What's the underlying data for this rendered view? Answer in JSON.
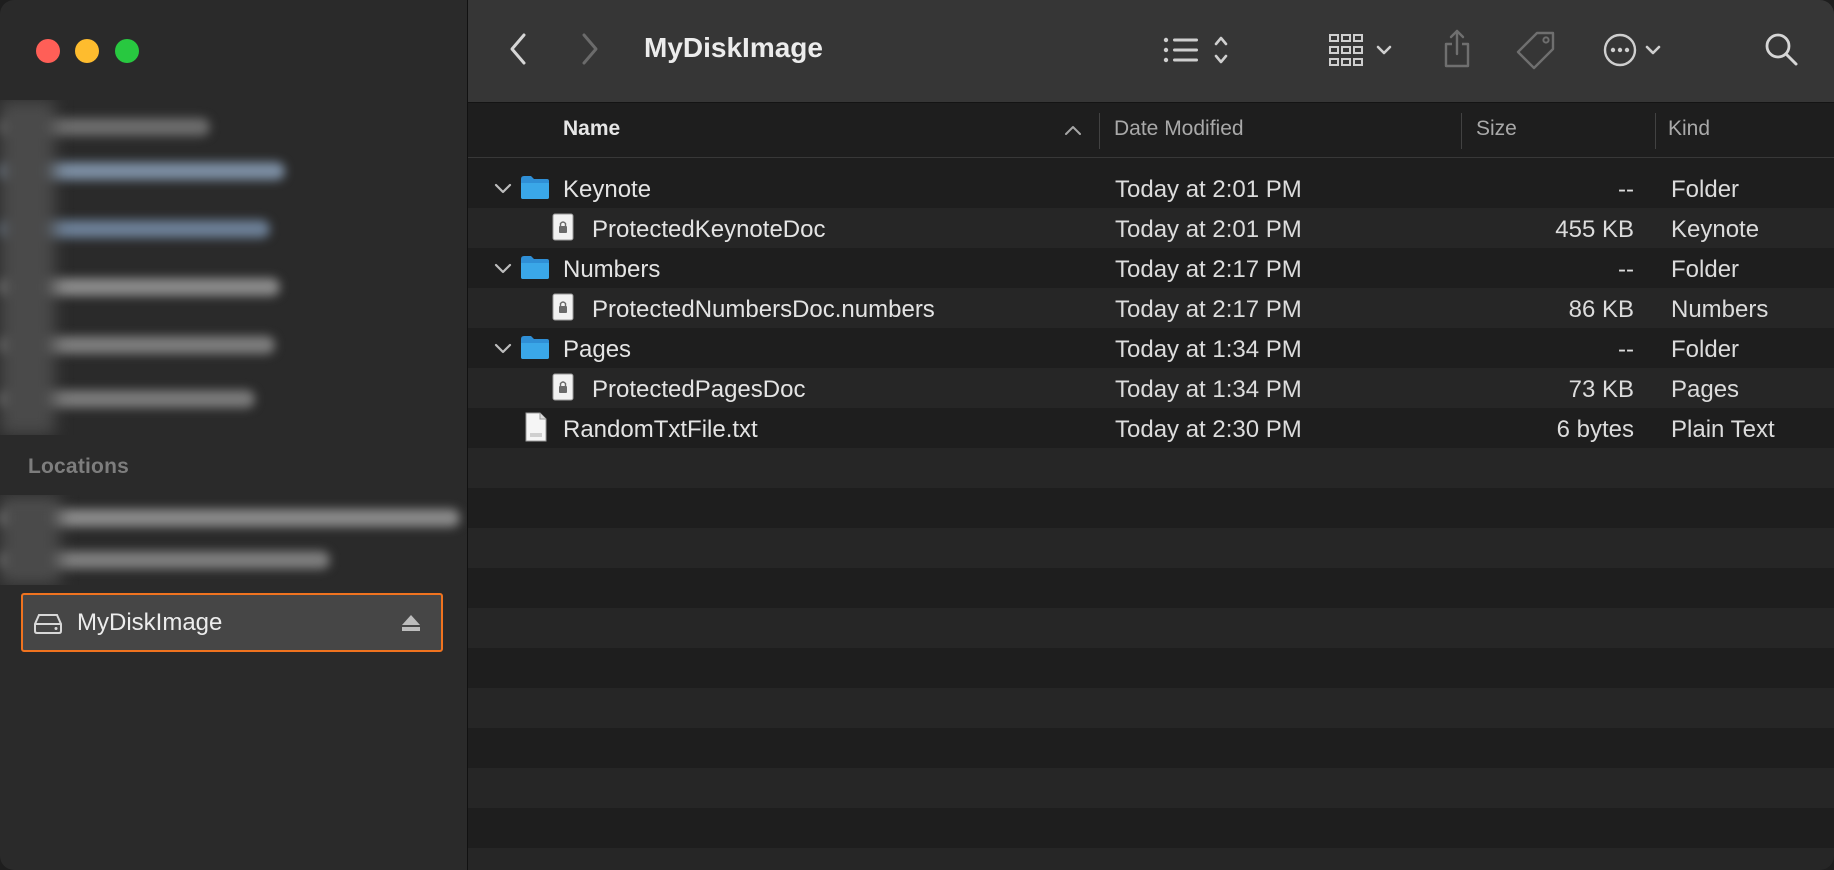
{
  "window": {
    "title": "MyDiskImage"
  },
  "sidebar": {
    "section_locations": "Locations",
    "selected_item": {
      "label": "MyDiskImage",
      "icon": "external-disk-icon"
    }
  },
  "toolbar": {
    "back_icon": "chevron-left-icon",
    "forward_icon": "chevron-right-icon",
    "view_icon": "list-view-icon",
    "group_icon": "grid-group-icon",
    "share_icon": "share-icon",
    "tag_icon": "tag-icon",
    "action_icon": "ellipsis-circle-icon",
    "search_icon": "search-icon"
  },
  "columns": {
    "name": "Name",
    "date": "Date Modified",
    "size": "Size",
    "kind": "Kind"
  },
  "rows": [
    {
      "name": "Keynote",
      "date": "Today at 2:01 PM",
      "size": "--",
      "kind": "Folder",
      "type": "folder",
      "level": 0,
      "expanded": true
    },
    {
      "name": "ProtectedKeynoteDoc",
      "date": "Today at 2:01 PM",
      "size": "455 KB",
      "kind": "Keynote",
      "type": "locked-doc",
      "level": 1
    },
    {
      "name": "Numbers",
      "date": "Today at 2:17 PM",
      "size": "--",
      "kind": "Folder",
      "type": "folder",
      "level": 0,
      "expanded": true
    },
    {
      "name": "ProtectedNumbersDoc.numbers",
      "date": "Today at 2:17 PM",
      "size": "86 KB",
      "kind": "Numbers",
      "type": "locked-doc",
      "level": 1
    },
    {
      "name": "Pages",
      "date": "Today at 1:34 PM",
      "size": "--",
      "kind": "Folder",
      "type": "folder",
      "level": 0,
      "expanded": true
    },
    {
      "name": "ProtectedPagesDoc",
      "date": "Today at 1:34 PM",
      "size": "73 KB",
      "kind": "Pages",
      "type": "locked-doc",
      "level": 1
    },
    {
      "name": "RandomTxtFile.txt",
      "date": "Today at 2:30 PM",
      "size": "6 bytes",
      "kind": "Plain Text",
      "type": "txt",
      "level": 0
    }
  ],
  "colors": {
    "selection_outline": "#f0731f",
    "folder_blue": "#3aa7e8"
  }
}
